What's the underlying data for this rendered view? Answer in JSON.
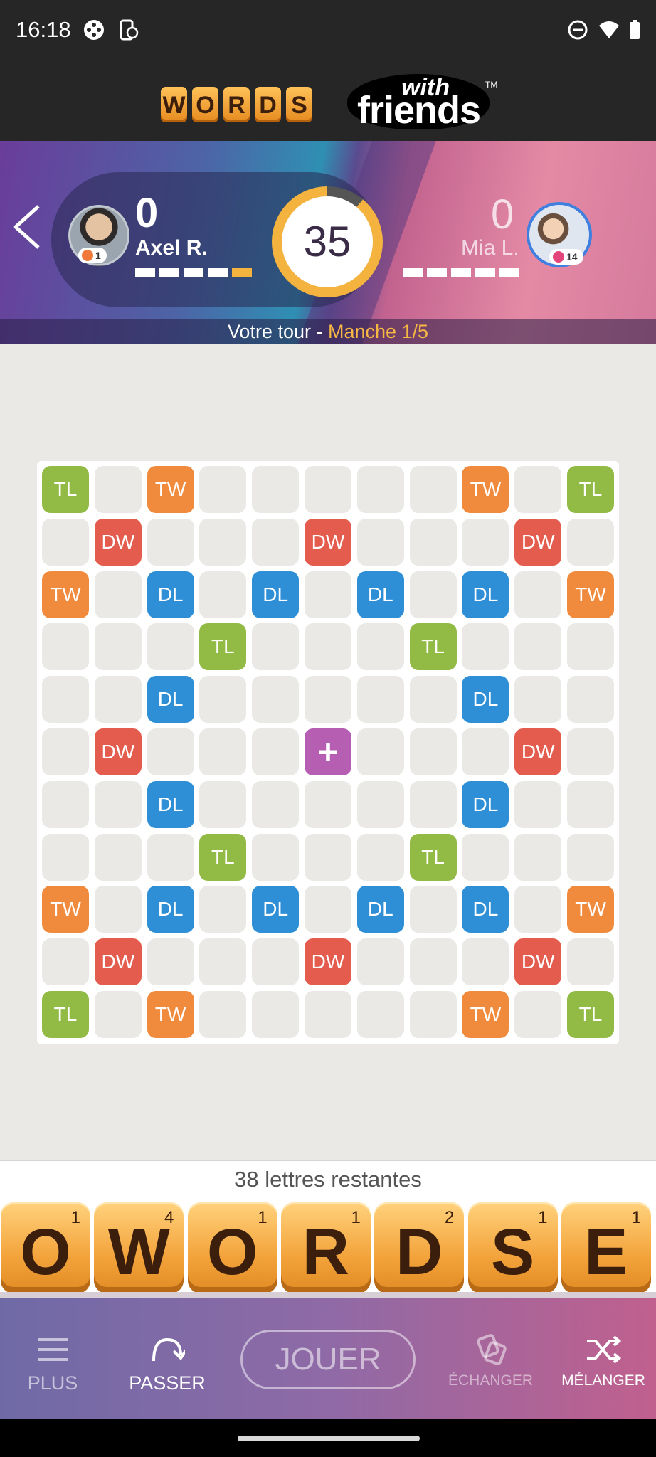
{
  "status_bar": {
    "time": "16:18",
    "icons": [
      "game-controller-icon",
      "phone-sync-icon",
      "do-not-disturb-icon",
      "wifi-icon",
      "battery-icon"
    ]
  },
  "header": {
    "logo_letters": [
      "W",
      "O",
      "R",
      "D",
      "S"
    ],
    "logo_with": "with",
    "logo_friends": "friends",
    "logo_tm": "TM"
  },
  "match": {
    "player_left": {
      "name": "Axel R.",
      "score": "0",
      "level": "1",
      "round_progress": [
        false,
        false,
        false,
        false,
        true
      ]
    },
    "player_right": {
      "name": "Mia L.",
      "score": "0",
      "level": "14",
      "round_progress": [
        false,
        false,
        false,
        false,
        false
      ]
    },
    "timer": "35",
    "timer_fraction_remaining": 0.89,
    "turn_text": "Votre tour - ",
    "round_text": "Manche 1/5"
  },
  "board": {
    "rows": [
      [
        "TL",
        "",
        "TW",
        "",
        "",
        "",
        "",
        "",
        "TW",
        "",
        "TL"
      ],
      [
        "",
        "DW",
        "",
        "",
        "",
        "DW",
        "",
        "",
        "",
        "DW",
        ""
      ],
      [
        "TW",
        "",
        "DL",
        "",
        "DL",
        "",
        "DL",
        "",
        "DL",
        "",
        "TW"
      ],
      [
        "",
        "",
        "",
        "TL",
        "",
        "",
        "",
        "TL",
        "",
        "",
        ""
      ],
      [
        "",
        "",
        "DL",
        "",
        "",
        "",
        "",
        "",
        "DL",
        "",
        ""
      ],
      [
        "",
        "DW",
        "",
        "",
        "",
        "+",
        "",
        "",
        "",
        "DW",
        ""
      ],
      [
        "",
        "",
        "DL",
        "",
        "",
        "",
        "",
        "",
        "DL",
        "",
        ""
      ],
      [
        "",
        "",
        "",
        "TL",
        "",
        "",
        "",
        "TL",
        "",
        "",
        ""
      ],
      [
        "TW",
        "",
        "DL",
        "",
        "DL",
        "",
        "DL",
        "",
        "DL",
        "",
        "TW"
      ],
      [
        "",
        "DW",
        "",
        "",
        "",
        "DW",
        "",
        "",
        "",
        "DW",
        ""
      ],
      [
        "TL",
        "",
        "TW",
        "",
        "",
        "",
        "",
        "",
        "TW",
        "",
        "TL"
      ]
    ]
  },
  "rack": {
    "remaining_text": "38 lettres restantes",
    "tiles": [
      {
        "letter": "O",
        "points": "1"
      },
      {
        "letter": "W",
        "points": "4"
      },
      {
        "letter": "O",
        "points": "1"
      },
      {
        "letter": "R",
        "points": "1"
      },
      {
        "letter": "D",
        "points": "2"
      },
      {
        "letter": "S",
        "points": "1"
      },
      {
        "letter": "E",
        "points": "1"
      }
    ]
  },
  "toolbar": {
    "plus_label": "PLUS",
    "pass_label": "PASSER",
    "play_label": "JOUER",
    "swap_label": "ÉCHANGER",
    "shuffle_label": "MÉLANGER"
  },
  "colors": {
    "tile_tl": "#91bb44",
    "tile_tw": "#f08a3c",
    "tile_dw": "#e45c4d",
    "tile_dl": "#2e8fd6",
    "tile_star": "#b65eb1",
    "accent_gold": "#f3b33e"
  }
}
